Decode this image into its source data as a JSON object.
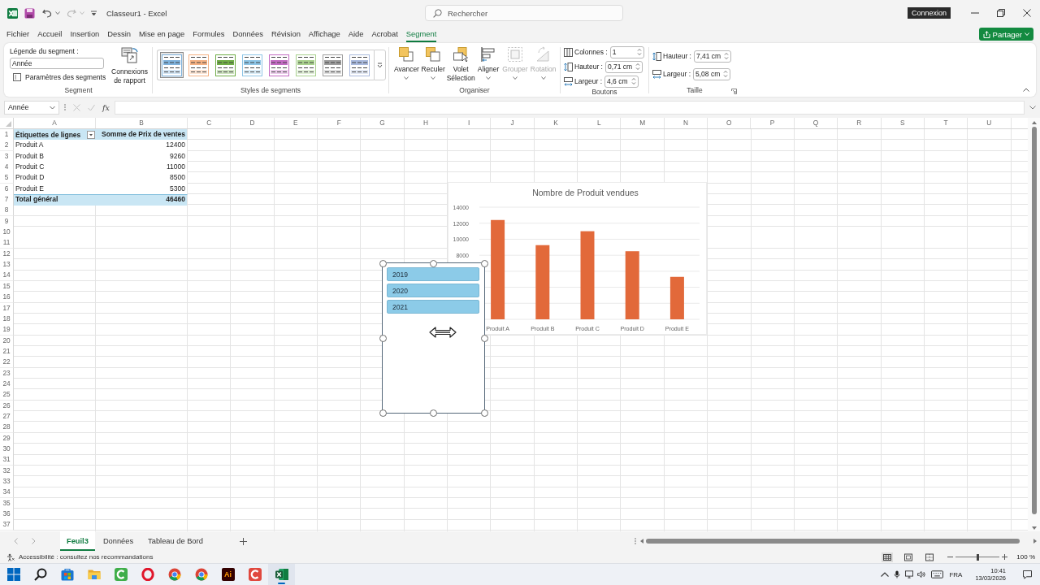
{
  "title_bar": {
    "document_title": "Classeur1 - Excel",
    "search": {
      "placeholder": "Rechercher"
    },
    "tooltip": "Connexion"
  },
  "menu_tabs": [
    {
      "label": "Fichier",
      "selected": false
    },
    {
      "label": "Accueil",
      "selected": false
    },
    {
      "label": "Insertion",
      "selected": false
    },
    {
      "label": "Dessin",
      "selected": false
    },
    {
      "label": "Mise en page",
      "selected": false
    },
    {
      "label": "Formules",
      "selected": false
    },
    {
      "label": "Données",
      "selected": false
    },
    {
      "label": "Révision",
      "selected": false
    },
    {
      "label": "Affichage",
      "selected": false
    },
    {
      "label": "Aide",
      "selected": false
    },
    {
      "label": "Acrobat",
      "selected": false
    },
    {
      "label": "Segment",
      "selected": true
    }
  ],
  "share_button": {
    "label": "Partager"
  },
  "ribbon": {
    "segment": {
      "caption_label": "Légende du segment :",
      "caption_value": "Année",
      "settings_button": "Paramètres des segments",
      "connections_button": "Connexions de rapport",
      "group_label": "Segment"
    },
    "styles": {
      "swatches": [
        {
          "color": "#7fb2dc",
          "selected": true
        },
        {
          "color": "#f4b183",
          "selected": false
        },
        {
          "color": "#70ad47",
          "selected": false
        },
        {
          "color": "#8ec5e6",
          "selected": false
        },
        {
          "color": "#c36bc3",
          "selected": false
        },
        {
          "color": "#a9d18e",
          "selected": false
        },
        {
          "color": "#9e9e9e",
          "selected": false
        },
        {
          "color": "#a9b9dd",
          "selected": false
        }
      ],
      "group_label": "Styles de segments"
    },
    "organize": {
      "buttons": [
        {
          "kind": "forward",
          "label": "Avancer",
          "dropdown": true,
          "disabled": false
        },
        {
          "kind": "backward",
          "label": "Reculer",
          "dropdown": true,
          "disabled": false
        },
        {
          "kind": "selection-pane",
          "label": "Volet Sélection",
          "dropdown": false,
          "disabled": false
        },
        {
          "kind": "align",
          "label": "Aligner",
          "dropdown": true,
          "disabled": false
        },
        {
          "kind": "group",
          "label": "Grouper",
          "dropdown": true,
          "disabled": true
        },
        {
          "kind": "rotate",
          "label": "Rotation",
          "dropdown": true,
          "disabled": true
        }
      ],
      "group_label": "Organiser"
    },
    "buttons_group": {
      "fields": [
        {
          "kind": "columns",
          "label": "Colonnes :",
          "value": "1"
        },
        {
          "kind": "height",
          "label": "Hauteur :",
          "value": "0,71 cm"
        },
        {
          "kind": "width",
          "label": "Largeur :",
          "value": "4,6 cm"
        }
      ],
      "group_label": "Boutons"
    },
    "size": {
      "fields": [
        {
          "kind": "height",
          "label": "Hauteur :",
          "value": "7,41 cm"
        },
        {
          "kind": "width",
          "label": "Largeur :",
          "value": "5,08 cm"
        }
      ],
      "group_label": "Taille"
    }
  },
  "formula_bar": {
    "name_box": "Année",
    "function_label": "fx"
  },
  "sheet": {
    "columns": [
      "A",
      "B",
      "C",
      "D",
      "E",
      "F",
      "G",
      "H",
      "I",
      "J",
      "K",
      "L",
      "M",
      "N",
      "O",
      "P",
      "Q",
      "R",
      "S",
      "T",
      "U"
    ],
    "row_numbers": [
      "1",
      "2",
      "3",
      "4",
      "5",
      "6",
      "7",
      "8",
      "9",
      "10",
      "11",
      "12",
      "13",
      "14",
      "15",
      "16",
      "17",
      "18",
      "19",
      "20",
      "21",
      "22",
      "23",
      "24",
      "25",
      "26",
      "27",
      "28",
      "29",
      "30",
      "31",
      "32",
      "33",
      "34",
      "35",
      "36",
      "37"
    ],
    "pivot_table": {
      "header": [
        "Étiquettes de lignes",
        "Somme de Prix de ventes"
      ],
      "rows": [
        {
          "label": "Produit A",
          "value": "12400"
        },
        {
          "label": "Produit B",
          "value": "9260"
        },
        {
          "label": "Produit C",
          "value": "11000"
        },
        {
          "label": "Produit D",
          "value": "8500"
        },
        {
          "label": "Produit E",
          "value": "5300"
        }
      ],
      "total": {
        "label": "Total général",
        "value": "46460"
      }
    },
    "chart": {
      "chart_data": {
        "type": "bar",
        "title": "Nombre de Produit vendues",
        "categories": [
          "Produit A",
          "Produit B",
          "Produit C",
          "Produit D",
          "Produit E"
        ],
        "values": [
          12400,
          9260,
          11000,
          8500,
          5300
        ],
        "ylim": [
          0,
          14000
        ],
        "yticks": [
          8000,
          10000,
          12000,
          14000
        ],
        "grid": true
      }
    },
    "slicer": {
      "selected": true,
      "items": [
        {
          "label": "2019",
          "selected": true
        },
        {
          "label": "2020",
          "selected": true
        },
        {
          "label": "2021",
          "selected": true
        }
      ]
    }
  },
  "sheet_tabs": [
    {
      "label": "Feuil3",
      "selected": true
    },
    {
      "label": "Données",
      "selected": false
    },
    {
      "label": "Tableau de Bord",
      "selected": false
    }
  ],
  "status_bar": {
    "accessibility": "Accessibilité : consultez nos recommandations",
    "view_modes": [
      {
        "kind": "normal",
        "selected": true
      },
      {
        "kind": "page-layout",
        "selected": false
      },
      {
        "kind": "page-break",
        "selected": false
      }
    ],
    "zoom_slider": {
      "level": 0.5
    },
    "zoom": "100 %"
  },
  "taskbar": {
    "apps": [
      {
        "kind": "start",
        "selected": false
      },
      {
        "kind": "search",
        "selected": false
      },
      {
        "kind": "store",
        "selected": false
      },
      {
        "kind": "files",
        "selected": false
      },
      {
        "kind": "arc-tile",
        "color": "#3fae49",
        "selected": false
      },
      {
        "kind": "ring",
        "selected": false
      },
      {
        "kind": "round-logo",
        "selected": false
      },
      {
        "kind": "round-logo",
        "selected": false
      },
      {
        "kind": "text-tile",
        "label": "Ai",
        "selected": false
      },
      {
        "kind": "arc-tile",
        "color": "#e0483e",
        "selected": false
      },
      {
        "kind": "sheet-tile",
        "selected": true
      }
    ],
    "tray": {
      "language": "FRA",
      "time": "10:41",
      "date": "13/03/2026"
    }
  }
}
